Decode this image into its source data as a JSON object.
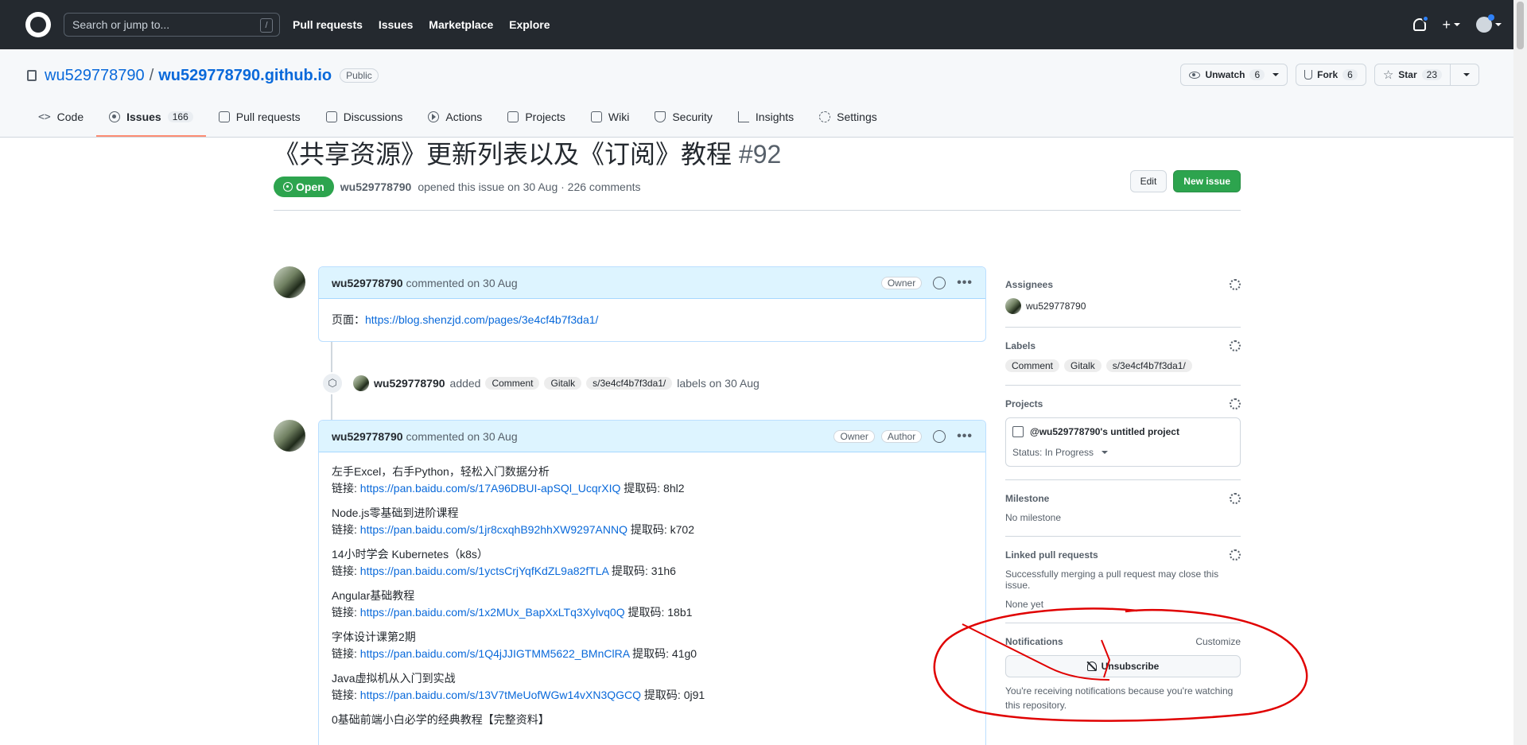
{
  "header": {
    "search_placeholder": "Search or jump to...",
    "search_shortcut": "/",
    "nav": [
      "Pull requests",
      "Issues",
      "Marketplace",
      "Explore"
    ],
    "plus_label": "+"
  },
  "repo": {
    "owner": "wu529778790",
    "separator": "/",
    "name": "wu529778790.github.io",
    "visibility": "Public",
    "unwatch_label": "Unwatch",
    "unwatch_count": "6",
    "fork_label": "Fork",
    "fork_count": "6",
    "star_label": "Star",
    "star_count": "23",
    "tabs": [
      {
        "label": "Code",
        "icon": "code-icon"
      },
      {
        "label": "Issues",
        "count": "166",
        "icon": "issue-icon",
        "selected": true
      },
      {
        "label": "Pull requests",
        "icon": "pull-request-icon"
      },
      {
        "label": "Discussions",
        "icon": "discussion-icon"
      },
      {
        "label": "Actions",
        "icon": "play-icon"
      },
      {
        "label": "Projects",
        "icon": "table-icon"
      },
      {
        "label": "Wiki",
        "icon": "book-icon"
      },
      {
        "label": "Security",
        "icon": "shield-icon"
      },
      {
        "label": "Insights",
        "icon": "graph-icon"
      },
      {
        "label": "Settings",
        "icon": "gear-icon"
      }
    ]
  },
  "issue": {
    "title": "《共享资源》更新列表以及《订阅》教程",
    "number": "#92",
    "edit_label": "Edit",
    "new_issue_label": "New issue",
    "state": "Open",
    "author": "wu529778790",
    "meta_text": "opened this issue on 30 Aug · 226 comments"
  },
  "timeline": {
    "comment1": {
      "author": "wu529778790",
      "meta": "commented on 30 Aug",
      "role": "Owner",
      "body_prefix": "页面：",
      "body_link": "https://blog.shenzjd.com/pages/3e4cf4b7f3da1/"
    },
    "event": {
      "author": "wu529778790",
      "action": "added",
      "labels": [
        "Comment",
        "Gitalk",
        "s/3e4cf4b7f3da1/"
      ],
      "suffix": "labels on 30 Aug"
    },
    "comment2": {
      "author": "wu529778790",
      "meta": "commented on 30 Aug",
      "role1": "Owner",
      "role2": "Author",
      "link_prefix": "链接: ",
      "items": [
        {
          "title": "左手Excel，右手Python，轻松入门数据分析",
          "link": "https://pan.baidu.com/s/17A96DBUI-apSQl_UcqrXIQ",
          "code": " 提取码: 8hl2"
        },
        {
          "title": "Node.js零基础到进阶课程",
          "link": "https://pan.baidu.com/s/1jr8cxqhB92hhXW9297ANNQ",
          "code": " 提取码: k702"
        },
        {
          "title": "14小时学会 Kubernetes（k8s）",
          "link": "https://pan.baidu.com/s/1yctsCrjYqfKdZL9a82fTLA",
          "code": " 提取码: 31h6"
        },
        {
          "title": "Angular基础教程",
          "link": "https://pan.baidu.com/s/1x2MUx_BapXxLTq3Xylvq0Q",
          "code": " 提取码: 18b1"
        },
        {
          "title": "字体设计课第2期",
          "link": "https://pan.baidu.com/s/1Q4jJJIGTMM5622_BMnClRA",
          "code": " 提取码: 41g0"
        },
        {
          "title": "Java虚拟机从入门到实战",
          "link": "https://pan.baidu.com/s/13V7tMeUofWGw14vXN3QGCQ",
          "code": " 提取码: 0j91"
        },
        {
          "title": "0基础前端小白必学的经典教程【完整资料】",
          "link": "",
          "code": ""
        }
      ]
    }
  },
  "sidebar": {
    "assignees_label": "Assignees",
    "assignee": "wu529778790",
    "labels_label": "Labels",
    "labels": [
      "Comment",
      "Gitalk",
      "s/3e4cf4b7f3da1/"
    ],
    "projects_label": "Projects",
    "project_name": "@wu529778790's untitled project",
    "project_status": "Status: In Progress",
    "milestone_label": "Milestone",
    "milestone_value": "No milestone",
    "linked_label": "Linked pull requests",
    "linked_desc": "Successfully merging a pull request may close this issue.",
    "linked_value": "None yet",
    "notifications_label": "Notifications",
    "customize_label": "Customize",
    "unsubscribe_label": "Unsubscribe",
    "notifications_note": "You're receiving notifications because you're watching this repository."
  },
  "colors": {
    "header_bg": "#24292f",
    "open_green": "#2da44e",
    "link_blue": "#0969da",
    "selected_tab_underline": "#fd8c73",
    "annotation_red": "#e00000"
  }
}
